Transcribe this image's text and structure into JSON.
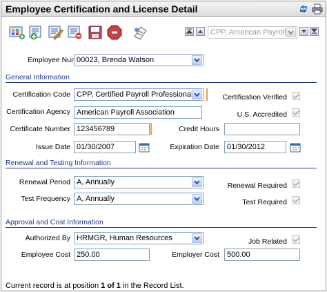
{
  "window": {
    "title": "Employee Certification and License Detail"
  },
  "toolbar": {
    "buttons": [
      "add-record-icon",
      "new-record-icon",
      "edit-record-icon",
      "delete-record-icon",
      "save-icon",
      "stop-icon",
      "notes-icon"
    ]
  },
  "record_selector": {
    "value": "CPP, American Payroll"
  },
  "employee": {
    "label": "Employee Number",
    "value": "00023, Brenda Watson"
  },
  "general": {
    "heading": "General Information",
    "cert_code_label": "Certification Code",
    "cert_code_value": "CPP, Certified Payroll Professional",
    "cert_verified_label": "Certification Verified",
    "agency_label": "Certification Agency",
    "agency_value": "American Payroll Association",
    "accredited_label": "U.S. Accredited",
    "cert_number_label": "Certificate Number",
    "cert_number_value": "123456789",
    "credit_hours_label": "Credit Hours",
    "credit_hours_value": "",
    "issue_date_label": "Issue Date",
    "issue_date_value": "01/30/2007",
    "expiration_date_label": "Expiration Date",
    "expiration_date_value": "01/30/2012"
  },
  "renewal": {
    "heading": "Renewal and Testing Information",
    "period_label": "Renewal Period",
    "period_value": "A, Annually",
    "renewal_required_label": "Renewal Required",
    "test_frequency_label": "Test Frequency",
    "test_frequency_value": "A, Annually",
    "test_required_label": "Test Required"
  },
  "approval": {
    "heading": "Approval and Cost Information",
    "authorized_label": "Authorized By",
    "authorized_value": "HRMGR, Human Resources",
    "job_related_label": "Job Related",
    "employee_cost_label": "Employee Cost",
    "employee_cost_value": "250.00",
    "employer_cost_label": "Employer Cost",
    "employer_cost_value": "500.00"
  },
  "status": {
    "prefix": "Current record is at position ",
    "position": "1 of 1",
    "suffix": " in the Record List."
  }
}
